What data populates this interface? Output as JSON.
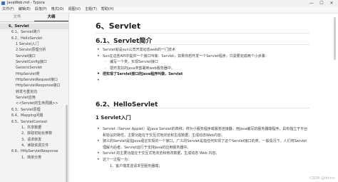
{
  "window": {
    "title": "JavaWeb.md - Typora",
    "controls": [
      "—",
      "☐",
      "✕"
    ]
  },
  "menu": [
    "文件(F)",
    "编辑(E)",
    "段落(P)",
    "格式(O)",
    "视图(V)",
    "主题(T)",
    "帮助(H)"
  ],
  "sidebar": {
    "tabs": [
      "文件",
      "大纲"
    ],
    "active_tab": "大纲",
    "outline": [
      {
        "text": "6、Servlet",
        "level": 1,
        "active": true
      },
      {
        "text": "6.1、Servlet简介",
        "level": 2
      },
      {
        "text": "6.2、HelloServlet",
        "level": 2
      },
      {
        "text": "1 Servlet入门",
        "level": 3
      },
      {
        "text": "2.Servlet原理分析",
        "level": 3
      },
      {
        "text": "Servlet接口",
        "level": 3
      },
      {
        "text": "ServletConfig接口",
        "level": 3
      },
      {
        "text": "GenericServlet",
        "level": 3
      },
      {
        "text": "HttpServlet类",
        "level": 3
      },
      {
        "text": "HttpServletRequest接口",
        "level": 3
      },
      {
        "text": "HttpServletResponse接口",
        "level": 3
      },
      {
        "text": "转发与重定向",
        "level": 3
      },
      {
        "text": "Servlet应用",
        "level": 3
      },
      {
        "text": "<<Servlet的生命周期>>",
        "level": 3
      },
      {
        "text": "6.3、Servlet原理",
        "level": 2
      },
      {
        "text": "6.4、Mapping问题",
        "level": 2
      },
      {
        "text": "6.5、ServletContext",
        "level": 2
      },
      {
        "text": "1、共享数据",
        "level": 4
      },
      {
        "text": "2、获取初始化参数",
        "level": 4
      },
      {
        "text": "3、请求转发",
        "level": 4
      },
      {
        "text": "4、读取资源文件",
        "level": 4
      },
      {
        "text": "6.6、HttpServletResponse",
        "level": 2
      },
      {
        "text": "1、简单分类",
        "level": 4
      }
    ]
  },
  "doc": {
    "h1": "6、Servlet",
    "s61_title": "6.1、Servlet简介",
    "s61_items": [
      "Servlet就是sun公司开发动态web的一门技术",
      "Sun在这些API中提供一个接口叫做：Servlet，如果你想开发一个Servlet程序，只需要完成两个小步骤：",
      "编写一个类，实现Servlet接口",
      "把开发好的java类部署到web服务器中。",
      "把实现了Servlet接口的Java程序叫做，Servlet"
    ],
    "s62_title": "6.2、HelloServlet",
    "s62_sub": "1 Servlet入门",
    "p1": "Servlet（Server Applet）是Java Servlet的简称，称为小服务程序或服务连接器，用Java编写的服务器端程序，具有独立于平台和协议的特性，主要功能在于交互式地浏览和生成数据，生成动态Web内容。",
    "p2": "狭义的Servlet是指Java语言实现的一个接口，广义的Servlet是指任何实现了这个Servlet接口的类，一般情况下，人们将Servlet理解为后者。Servlet运行于支持Java的应用服务器中。",
    "p3": "Servlet 的主要功能在于交互式地浏览和修改数据，生成动态 Web 内容。",
    "p4": "这个一过程一为：",
    "p5": "1、客户端发送请求至服务器端；"
  },
  "watermark": "CSDN @ibhnlc"
}
